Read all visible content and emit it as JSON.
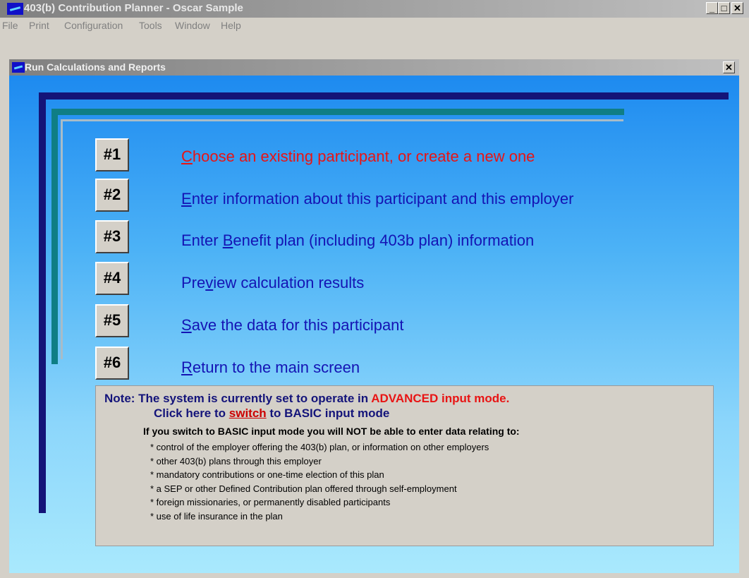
{
  "window": {
    "title": "403(b) Contribution Planner - Oscar Sample",
    "controls": {
      "minimize": "_",
      "maximize": "□",
      "close": "✕"
    }
  },
  "menu": {
    "items": [
      "File",
      "Print",
      "Configuration",
      "Tools",
      "Window",
      "Help"
    ]
  },
  "child_window": {
    "title": "Run Calculations and Reports",
    "close": "✕"
  },
  "steps": [
    {
      "number": "#1",
      "hotkey": "C",
      "rest": "hoose an existing participant, or create a new one",
      "pre": ""
    },
    {
      "number": "#2",
      "hotkey": "E",
      "rest": "nter information about this participant and this employer",
      "pre": ""
    },
    {
      "number": "#3",
      "pre": "Enter ",
      "hotkey": "B",
      "rest": "enefit plan (including 403b plan) information"
    },
    {
      "number": "#4",
      "pre": "Pre",
      "hotkey": "v",
      "rest": "iew calculation results"
    },
    {
      "number": "#5",
      "pre": "",
      "hotkey": "S",
      "rest": "ave the data for this participant"
    },
    {
      "number": "#6",
      "pre": "",
      "hotkey": "R",
      "rest": "eturn to the main screen"
    }
  ],
  "note": {
    "line1_prefix": "Note: The system is currently set to operate in ",
    "mode": "ADVANCED input mode.",
    "line2_prefix": "Click here to ",
    "switch_link": "switch",
    "line2_suffix": " to BASIC input mode",
    "warning": "If you switch to BASIC input mode you will NOT be able to enter data relating to:",
    "items": [
      "* control of the employer offering the 403(b) plan, or information on other employers",
      "* other 403(b) plans through this employer",
      "* mandatory contributions or one-time election of this plan",
      "* a SEP or other Defined Contribution plan offered through self-employment",
      "* foreign missionaries, or permanently disabled participants",
      "* use of life insurance in the plan"
    ]
  }
}
